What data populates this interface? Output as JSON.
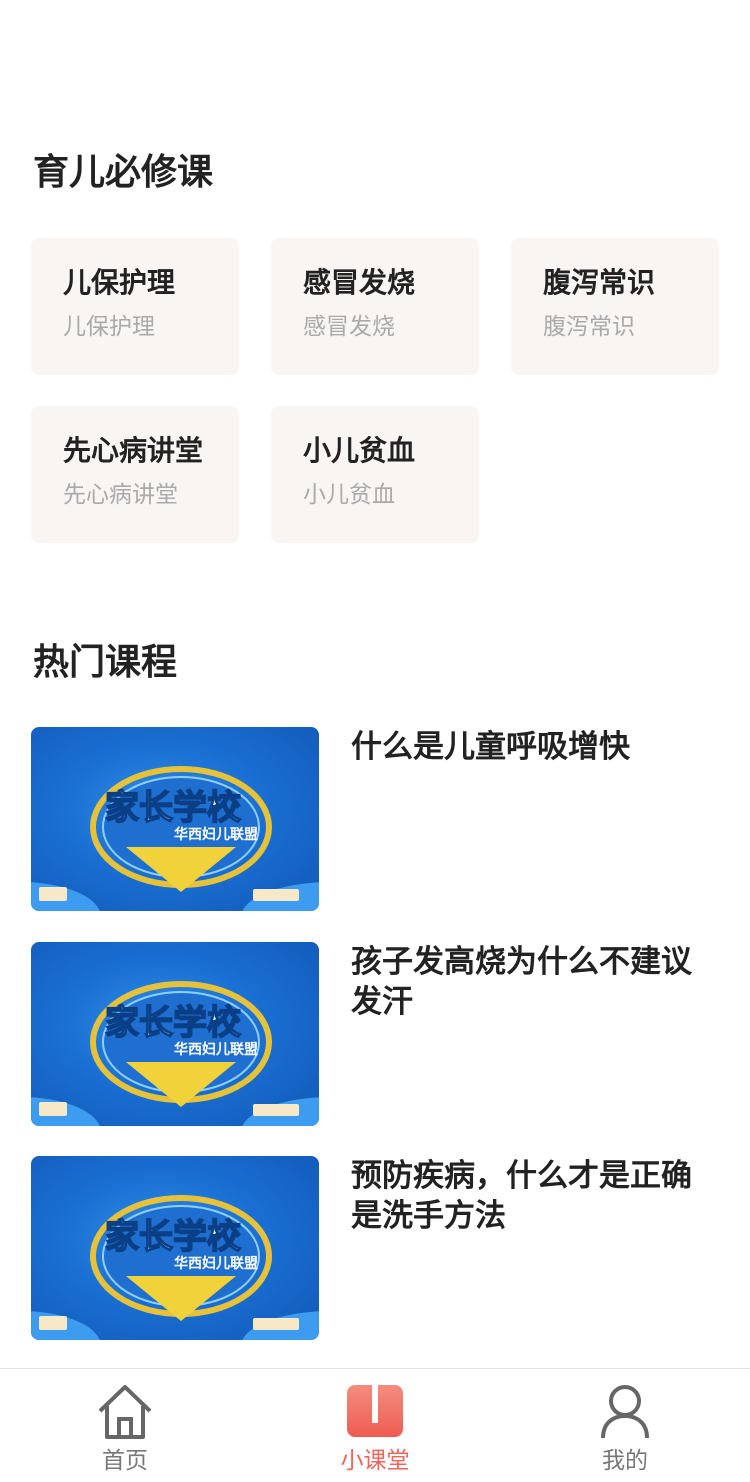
{
  "sections": {
    "required": "育儿必修课",
    "hot": "热门课程"
  },
  "categories": [
    {
      "title": "儿保护理",
      "subtitle": "儿保护理"
    },
    {
      "title": "感冒发烧",
      "subtitle": "感冒发烧"
    },
    {
      "title": "腹泻常识",
      "subtitle": "腹泻常识"
    },
    {
      "title": "先心病讲堂",
      "subtitle": "先心病讲堂"
    },
    {
      "title": "小儿贫血",
      "subtitle": "小儿贫血"
    }
  ],
  "courses": [
    {
      "title": "什么是儿童呼吸增快",
      "thumb_text": "家长学校",
      "thumb_sub": "华西妇儿联盟"
    },
    {
      "title": "孩子发高烧为什么不建议发汗",
      "thumb_text": "家长学校",
      "thumb_sub": "华西妇儿联盟"
    },
    {
      "title": "预防疾病，什么才是正确是洗手方法",
      "thumb_text": "家长学校",
      "thumb_sub": "华西妇儿联盟"
    }
  ],
  "tabs": [
    {
      "label": "首页",
      "icon": "home-icon",
      "active": false
    },
    {
      "label": "小课堂",
      "icon": "book-icon",
      "active": true
    },
    {
      "label": "我的",
      "icon": "person-icon",
      "active": false
    }
  ],
  "colors": {
    "accent": "#f0645a",
    "card_bg": "#f8f5f2",
    "thumb_blue": "#1a6fd2"
  }
}
